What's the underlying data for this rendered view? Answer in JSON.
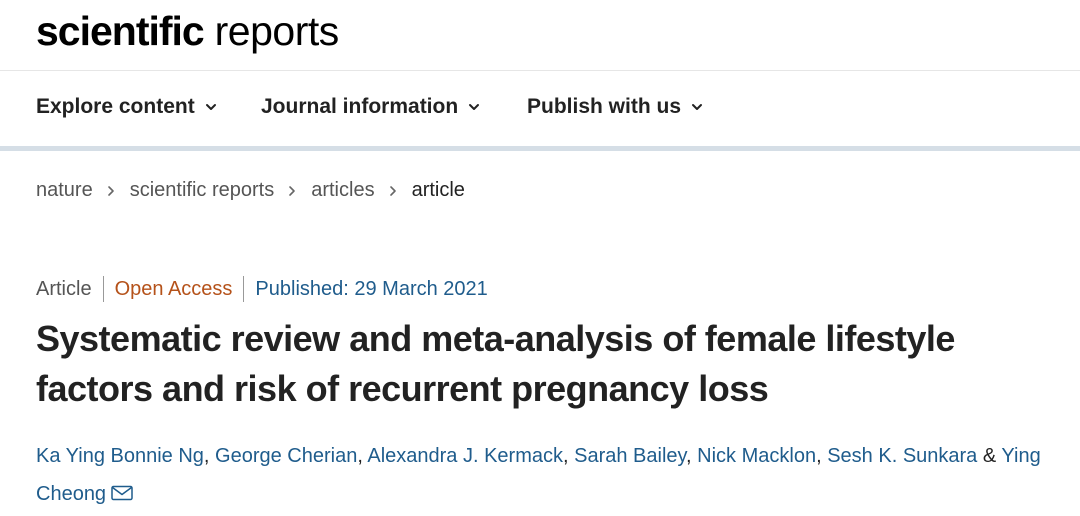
{
  "header": {
    "logo_bold": "scientific",
    "logo_light": "reports"
  },
  "nav": {
    "items": [
      {
        "label": "Explore content"
      },
      {
        "label": "Journal information"
      },
      {
        "label": "Publish with us"
      }
    ]
  },
  "breadcrumb": {
    "items": [
      {
        "label": "nature"
      },
      {
        "label": "scientific reports"
      },
      {
        "label": "articles"
      },
      {
        "label": "article"
      }
    ]
  },
  "article": {
    "type": "Article",
    "access": "Open Access",
    "published": "Published: 29 March 2021",
    "title": "Systematic review and meta-analysis of female lifestyle factors and risk of recurrent pregnancy loss",
    "authors": [
      "Ka Ying Bonnie Ng",
      "George Cherian",
      "Alexandra J. Kermack",
      "Sarah Bailey",
      "Nick Macklon",
      "Sesh K. Sunkara",
      "Ying Cheong"
    ],
    "author_separator": ", ",
    "final_joiner": " & "
  },
  "colors": {
    "link": "#1f5c8c",
    "open_access": "#b5521a",
    "divider": "#d5dee6"
  },
  "icons": {
    "nav_chevron": "chevron-down-icon",
    "breadcrumb_separator": "chevron-right-icon",
    "corresponding_author": "mail-icon"
  }
}
